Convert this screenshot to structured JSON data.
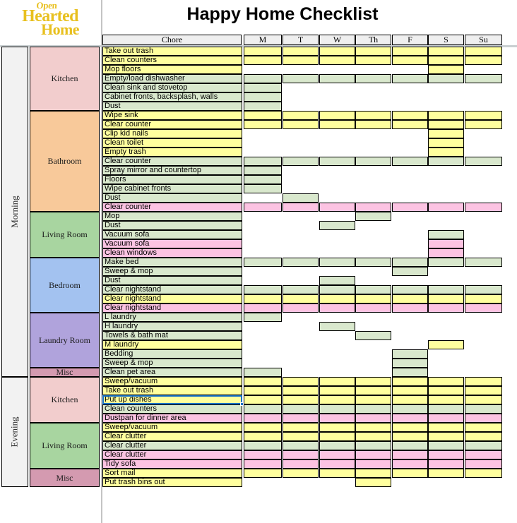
{
  "app": {
    "title": "Happy Home Checklist",
    "logo": {
      "line1": "Open",
      "line2": "Hearted",
      "line3": "Home",
      "color": "#e8c01f"
    }
  },
  "columns": {
    "chore_header": "Chore",
    "days": [
      "M",
      "T",
      "W",
      "Th",
      "F",
      "S",
      "Su"
    ]
  },
  "colors": {
    "yellow": "#ffff9e",
    "green": "#d9e8cd",
    "pink": "#fcc3e2",
    "selection": "#1a73c8",
    "kitchen": "#f2cdcd",
    "bathroom": "#f8c99a",
    "living_room": "#a8d5a0",
    "bedroom": "#a3c2f0",
    "laundry_room": "#b0a3dc",
    "misc": "#d49ab0"
  },
  "selection": {
    "cell_text": "Put up dishes",
    "section": "Evening",
    "room": "Kitchen"
  },
  "sections": [
    {
      "period": "Morning",
      "rooms": [
        {
          "room": "Kitchen",
          "color": "#f2cdcd",
          "chores": [
            {
              "label": "Take out trash",
              "color": "yellow",
              "days": [
                1,
                1,
                1,
                1,
                1,
                1,
                1
              ]
            },
            {
              "label": "Clean counters",
              "color": "yellow",
              "days": [
                1,
                1,
                1,
                1,
                1,
                1,
                1
              ]
            },
            {
              "label": "Mop floors",
              "color": "yellow",
              "days": [
                0,
                0,
                0,
                0,
                0,
                1,
                0
              ]
            },
            {
              "label": "Empty/load dishwasher",
              "color": "green",
              "days": [
                1,
                1,
                1,
                1,
                1,
                1,
                1
              ]
            },
            {
              "label": "Clean sink and stovetop",
              "color": "green",
              "days": [
                1,
                0,
                0,
                0,
                0,
                0,
                0
              ]
            },
            {
              "label": "Cabinet fronts, backsplash, walls",
              "color": "green",
              "days": [
                1,
                0,
                0,
                0,
                0,
                0,
                0
              ]
            },
            {
              "label": "Dust",
              "color": "green",
              "days": [
                1,
                0,
                0,
                0,
                0,
                0,
                0
              ]
            }
          ]
        },
        {
          "room": "Bathroom",
          "color": "#f8c99a",
          "chores": [
            {
              "label": "Wipe sink",
              "color": "yellow",
              "days": [
                1,
                1,
                1,
                1,
                1,
                1,
                1
              ]
            },
            {
              "label": "Clear counter",
              "color": "yellow",
              "days": [
                1,
                1,
                1,
                1,
                1,
                1,
                1
              ]
            },
            {
              "label": "Clip kid nails",
              "color": "yellow",
              "days": [
                0,
                0,
                0,
                0,
                0,
                1,
                0
              ]
            },
            {
              "label": "Clean toilet",
              "color": "yellow",
              "days": [
                0,
                0,
                0,
                0,
                0,
                1,
                0
              ]
            },
            {
              "label": "Empty trash",
              "color": "yellow",
              "days": [
                0,
                0,
                0,
                0,
                0,
                1,
                0
              ]
            },
            {
              "label": "Clear counter",
              "color": "green",
              "days": [
                1,
                1,
                1,
                1,
                1,
                1,
                1
              ]
            },
            {
              "label": "Spray mirror and countertop",
              "color": "green",
              "days": [
                1,
                0,
                0,
                0,
                0,
                0,
                0
              ]
            },
            {
              "label": "Floors",
              "color": "green",
              "days": [
                1,
                0,
                0,
                0,
                0,
                0,
                0
              ]
            },
            {
              "label": "Wipe cabinet fronts",
              "color": "green",
              "days": [
                1,
                0,
                0,
                0,
                0,
                0,
                0
              ]
            },
            {
              "label": "Dust",
              "color": "green",
              "days": [
                0,
                1,
                0,
                0,
                0,
                0,
                0
              ]
            },
            {
              "label": "Clear counter",
              "color": "pink",
              "days": [
                1,
                1,
                1,
                1,
                1,
                1,
                1
              ]
            }
          ]
        },
        {
          "room": "Living Room",
          "color": "#a8d5a0",
          "chores": [
            {
              "label": "Mop",
              "color": "green",
              "days": [
                0,
                0,
                0,
                1,
                0,
                0,
                0
              ]
            },
            {
              "label": "Dust",
              "color": "green",
              "days": [
                0,
                0,
                1,
                0,
                0,
                0,
                0
              ]
            },
            {
              "label": "Vacuum sofa",
              "color": "green",
              "days": [
                0,
                0,
                0,
                0,
                0,
                1,
                0
              ]
            },
            {
              "label": "Vacuum sofa",
              "color": "pink",
              "days": [
                0,
                0,
                0,
                0,
                0,
                1,
                0
              ]
            },
            {
              "label": "Clean windows",
              "color": "pink",
              "days": [
                0,
                0,
                0,
                0,
                0,
                1,
                0
              ]
            }
          ]
        },
        {
          "room": "Bedroom",
          "color": "#a3c2f0",
          "chores": [
            {
              "label": "Make bed",
              "color": "green",
              "days": [
                1,
                1,
                1,
                1,
                1,
                1,
                1
              ]
            },
            {
              "label": "Sweep & mop",
              "color": "green",
              "days": [
                0,
                0,
                0,
                0,
                1,
                0,
                0
              ]
            },
            {
              "label": "Dust",
              "color": "green",
              "days": [
                0,
                0,
                1,
                0,
                0,
                0,
                0
              ]
            },
            {
              "label": "Clear nightstand",
              "color": "green",
              "days": [
                1,
                1,
                1,
                1,
                1,
                1,
                1
              ]
            },
            {
              "label": "Clear nightstand",
              "color": "yellow",
              "days": [
                1,
                1,
                1,
                1,
                1,
                1,
                1
              ]
            },
            {
              "label": "Clear nightstand",
              "color": "pink",
              "days": [
                1,
                1,
                1,
                1,
                1,
                1,
                1
              ]
            }
          ]
        },
        {
          "room": "Laundry Room",
          "color": "#b0a3dc",
          "chores": [
            {
              "label": "L laundry",
              "color": "green",
              "days": [
                1,
                0,
                0,
                0,
                0,
                0,
                0
              ]
            },
            {
              "label": "H laundry",
              "color": "green",
              "days": [
                0,
                0,
                1,
                0,
                0,
                0,
                0
              ]
            },
            {
              "label": "Towels & bath mat",
              "color": "green",
              "days": [
                0,
                0,
                0,
                1,
                0,
                0,
                0
              ]
            },
            {
              "label": "M laundry",
              "color": "yellow",
              "days": [
                0,
                0,
                0,
                0,
                0,
                1,
                0
              ]
            },
            {
              "label": "Bedding",
              "color": "green",
              "days": [
                0,
                0,
                0,
                0,
                1,
                0,
                0
              ]
            },
            {
              "label": "Sweep & mop",
              "color": "green",
              "days": [
                0,
                0,
                0,
                0,
                1,
                0,
                0
              ]
            }
          ]
        },
        {
          "room": "Misc",
          "color": "#d49ab0",
          "chores": [
            {
              "label": "Clean pet area",
              "color": "green",
              "days": [
                1,
                0,
                0,
                0,
                1,
                0,
                0
              ]
            }
          ]
        }
      ]
    },
    {
      "period": "Evening",
      "rooms": [
        {
          "room": "Kitchen",
          "color": "#f2cdcd",
          "chores": [
            {
              "label": "Sweep/vacuum",
              "color": "yellow",
              "days": [
                1,
                1,
                1,
                1,
                1,
                1,
                1
              ]
            },
            {
              "label": "Take out trash",
              "color": "yellow",
              "days": [
                1,
                1,
                1,
                1,
                1,
                1,
                1
              ]
            },
            {
              "label": "Put up dishes",
              "color": "yellow",
              "days": [
                1,
                1,
                1,
                1,
                1,
                1,
                1
              ]
            },
            {
              "label": "Clean counters",
              "color": "green",
              "days": [
                1,
                1,
                1,
                1,
                1,
                1,
                1
              ]
            },
            {
              "label": "Dustpan for dinner area",
              "color": "pink",
              "days": [
                1,
                1,
                1,
                1,
                1,
                1,
                1
              ]
            }
          ]
        },
        {
          "room": "Living Room",
          "color": "#a8d5a0",
          "chores": [
            {
              "label": "Sweep/vacuum",
              "color": "yellow",
              "days": [
                1,
                1,
                1,
                1,
                1,
                1,
                1
              ]
            },
            {
              "label": "Clear clutter",
              "color": "yellow",
              "days": [
                1,
                1,
                1,
                1,
                1,
                1,
                1
              ]
            },
            {
              "label": "Clear clutter",
              "color": "green",
              "days": [
                1,
                1,
                1,
                1,
                1,
                1,
                1
              ]
            },
            {
              "label": "Clear clutter",
              "color": "pink",
              "days": [
                1,
                1,
                1,
                1,
                1,
                1,
                1
              ]
            },
            {
              "label": "Tidy sofa",
              "color": "pink",
              "days": [
                1,
                1,
                1,
                1,
                1,
                1,
                1
              ]
            }
          ]
        },
        {
          "room": "Misc",
          "color": "#d49ab0",
          "chores": [
            {
              "label": "Sort mail",
              "color": "yellow",
              "days": [
                1,
                1,
                1,
                1,
                1,
                1,
                1
              ]
            },
            {
              "label": "Put trash bins out",
              "color": "yellow",
              "days": [
                0,
                0,
                0,
                1,
                0,
                0,
                0
              ]
            }
          ]
        }
      ]
    }
  ]
}
